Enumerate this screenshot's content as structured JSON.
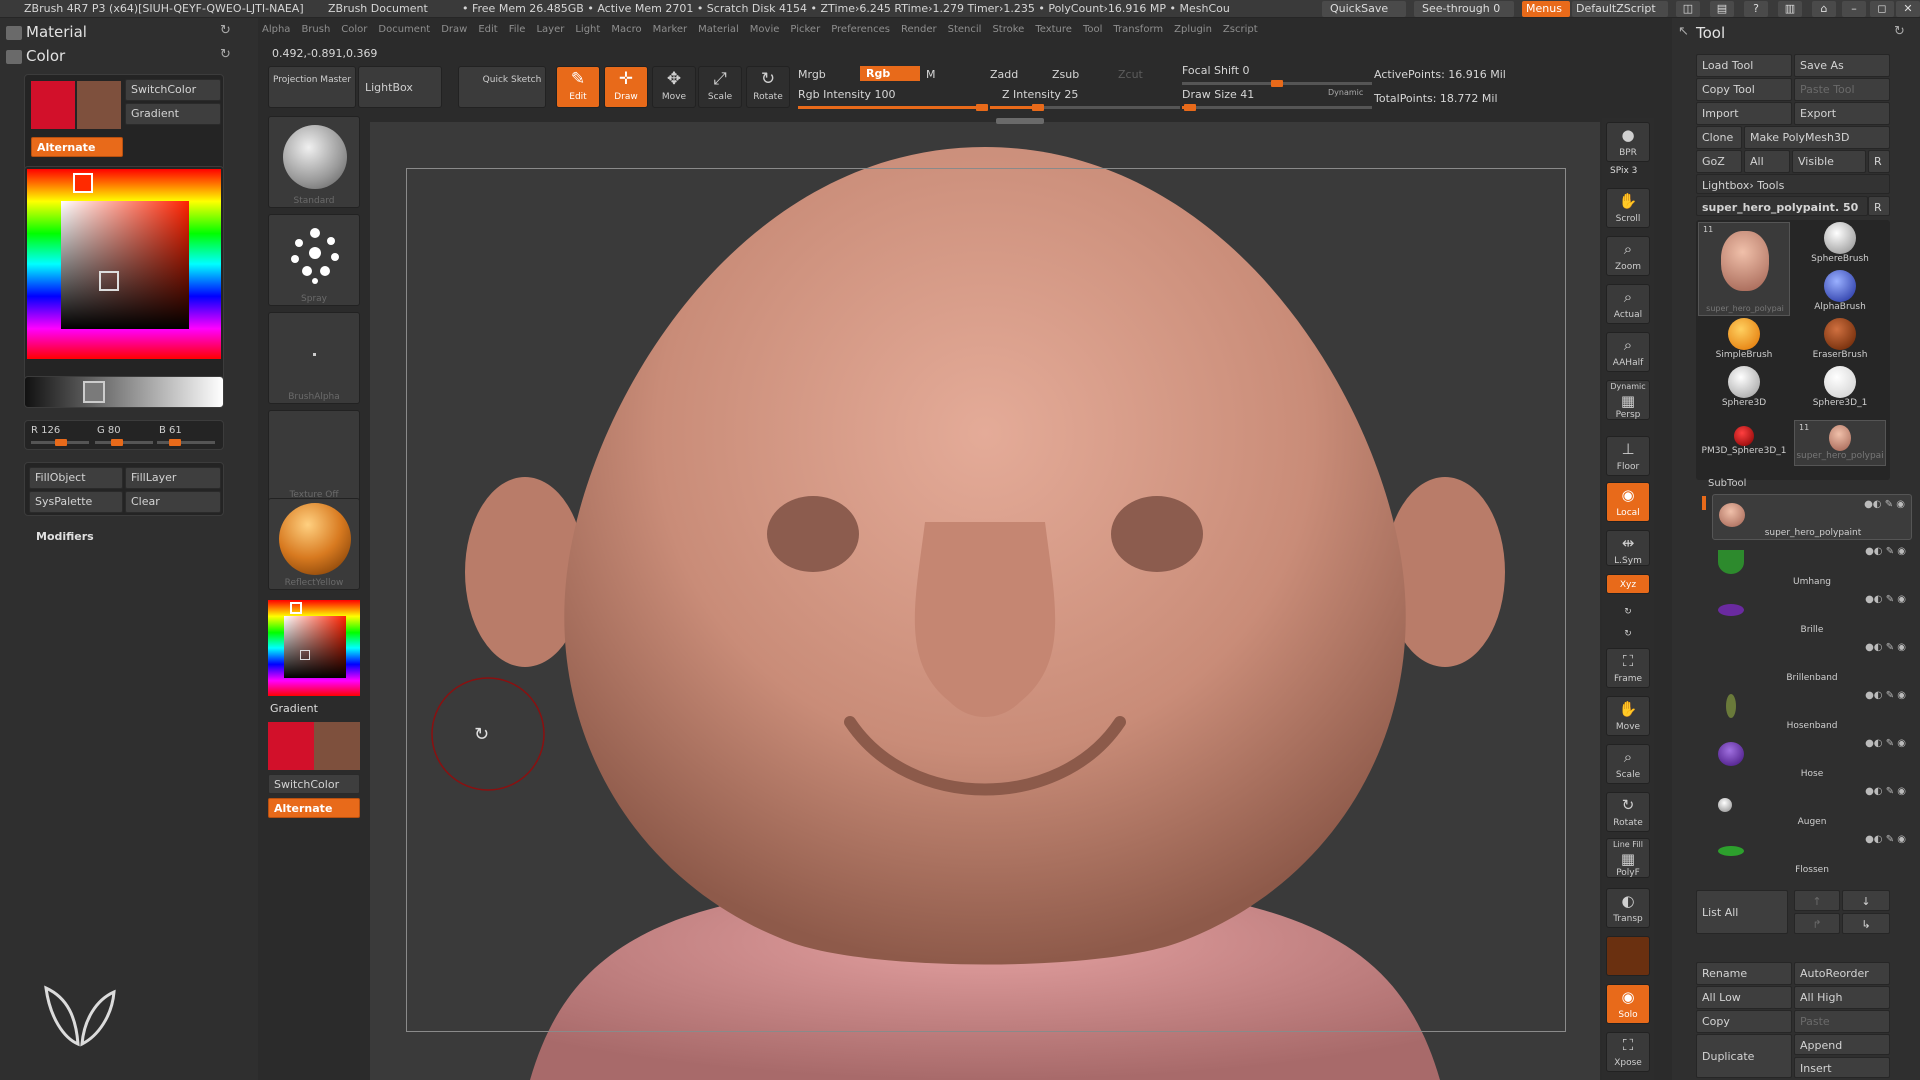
{
  "titlebar": {
    "app": "ZBrush 4R7 P3 (x64)[SIUH-QEYF-QWEO-LJTI-NAEA]",
    "doc": "ZBrush Document",
    "stats": "• Free Mem 26.485GB • Active Mem 2701 • Scratch Disk 4154 • ZTime›6.245 RTime›1.279 Timer›1.235 • PolyCount›16.916 MP • MeshCou",
    "quicksave": "QuickSave",
    "seethrough": "See-through  0",
    "menus": "Menus",
    "script": "DefaultZScript"
  },
  "menubar": [
    "Alpha",
    "Brush",
    "Color",
    "Document",
    "Draw",
    "Edit",
    "File",
    "Layer",
    "Light",
    "Macro",
    "Marker",
    "Material",
    "Movie",
    "Picker",
    "Preferences",
    "Render",
    "Stencil",
    "Stroke",
    "Texture",
    "Tool",
    "Transform",
    "Zplugin",
    "Zscript"
  ],
  "coords": "0.492,-0.891,0.369",
  "left": {
    "material": "Material",
    "color": "Color",
    "switchcolor": "SwitchColor",
    "gradient": "Gradient",
    "alternate": "Alternate",
    "r": "R 126",
    "g": "G 80",
    "b": "B 61",
    "fillobject": "FillObject",
    "filllayer": "FillLayer",
    "syspalette": "SysPalette",
    "clear": "Clear",
    "modifiers": "Modifiers",
    "colors": {
      "main": "#d2102a",
      "secondary": "#7e503d",
      "accent": "#e86a1a"
    }
  },
  "brushcol": {
    "standard": "Standard",
    "spray": "Spray",
    "brushalpha": "BrushAlpha",
    "texture": "Texture Off",
    "material": "ReflectYellow",
    "gradient": "Gradient",
    "switchcolor": "SwitchColor",
    "alternate": "Alternate"
  },
  "shelf": {
    "projection": "Projection Master",
    "lightbox": "LightBox",
    "quicksketch": "Quick Sketch",
    "edit": "Edit",
    "draw": "Draw",
    "move": "Move",
    "scale": "Scale",
    "rotate": "Rotate",
    "mrgb": "Mrgb",
    "rgb": "Rgb",
    "m": "M",
    "rgbint": "Rgb Intensity 100",
    "zadd": "Zadd",
    "zsub": "Zsub",
    "zcut": "Zcut",
    "zint": "Z Intensity 25",
    "focal": "Focal Shift 0",
    "drawsize": "Draw Size 41",
    "dynamic": "Dynamic",
    "activepts": "ActivePoints: 16.916  Mil",
    "totalpts": "TotalPoints: 18.772  Mil",
    "rgb_intensity": 100,
    "z_intensity": 25,
    "draw_size": 41
  },
  "rightshelf": {
    "bpr": "BPR",
    "spix": "SPix 3",
    "scroll": "Scroll",
    "zoom": "Zoom",
    "actual": "Actual",
    "aahalf": "AAHalf",
    "dynamic": "Dynamic",
    "persp": "Persp",
    "floor": "Floor",
    "local": "Local",
    "lsym": "L.Sym",
    "xyz": "Xyz",
    "frame": "Frame",
    "move": "Move",
    "scale": "Scale",
    "rotate": "Rotate",
    "linefill": "Line Fill",
    "polyf": "PolyF",
    "transp": "Transp",
    "solo": "Solo",
    "xpose": "Xpose"
  },
  "tool": {
    "title": "Tool",
    "loadtool": "Load Tool",
    "saveas": "Save As",
    "copytool": "Copy Tool",
    "pastetool": "Paste Tool",
    "import": "Import",
    "export": "Export",
    "clone": "Clone",
    "makepoly": "Make PolyMesh3D",
    "goz": "GoZ",
    "all": "All",
    "visible": "Visible",
    "r": "R",
    "lightboxtools": "Lightbox› Tools",
    "current": "super_hero_polypaint. 50",
    "thumbs": [
      "super_hero_polypai",
      "SphereBrush",
      "AlphaBrush",
      "SimpleBrush",
      "EraserBrush",
      "Sphere3D",
      "Sphere3D_1",
      "PM3D_Sphere3D_1",
      "super_hero_polypai"
    ],
    "subtool_title": "SubTool",
    "subtools": [
      "super_hero_polypaint",
      "Umhang",
      "Brille",
      "Brillenband",
      "Hosenband",
      "Hose",
      "Augen",
      "Flossen"
    ],
    "listall": "List All",
    "rename": "Rename",
    "autoreorder": "AutoReorder",
    "alllow": "All Low",
    "allhigh": "All High",
    "copy": "Copy",
    "paste": "Paste",
    "duplicate": "Duplicate",
    "append": "Append",
    "insert": "Insert"
  }
}
